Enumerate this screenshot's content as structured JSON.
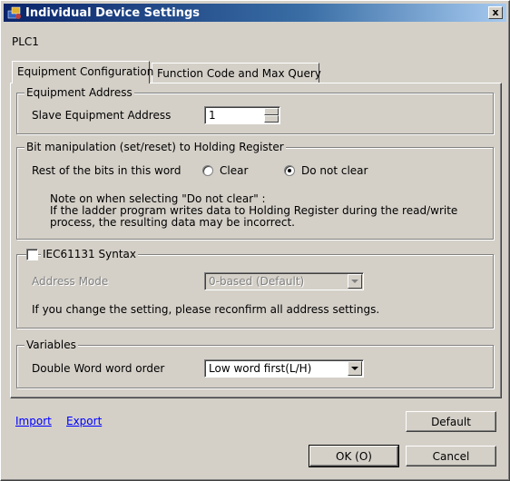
{
  "window": {
    "title": "Individual Device Settings",
    "close_label": "x"
  },
  "device": "PLC1",
  "tabs": [
    {
      "label": "Equipment Configuration",
      "active": true
    },
    {
      "label": "Function Code and Max Query",
      "active": false
    }
  ],
  "equipment_address": {
    "group_label": "Equipment Address",
    "slave_label": "Slave Equipment Address",
    "slave_value": "1"
  },
  "bit_manipulation": {
    "group_label": "Bit manipulation (set/reset) to Holding Register",
    "rest_label": "Rest of the bits in this word",
    "option_clear": "Clear",
    "option_do_not_clear": "Do not clear",
    "selected": "Do not clear",
    "note_line1": "Note on when selecting \"Do not clear\" :",
    "note_line2": "If the ladder program writes data to Holding Register during the read/write",
    "note_line3": "process, the resulting data may be incorrect."
  },
  "iec": {
    "checkbox_label": "IEC61131 Syntax",
    "checked": false,
    "address_mode_label": "Address Mode",
    "address_mode_value": "0-based (Default)",
    "info": "If you change the setting, please reconfirm all address settings."
  },
  "variables": {
    "group_label": "Variables",
    "dword_label": "Double Word word order",
    "dword_value": "Low word first(L/H)"
  },
  "links": {
    "import": "Import",
    "export": "Export"
  },
  "buttons": {
    "default": "Default",
    "ok": "OK (O)",
    "cancel": "Cancel"
  },
  "colors": {
    "title_start": "#0a246a",
    "title_end": "#a6caf0",
    "face": "#d4d0c8",
    "link": "#0000ff"
  }
}
